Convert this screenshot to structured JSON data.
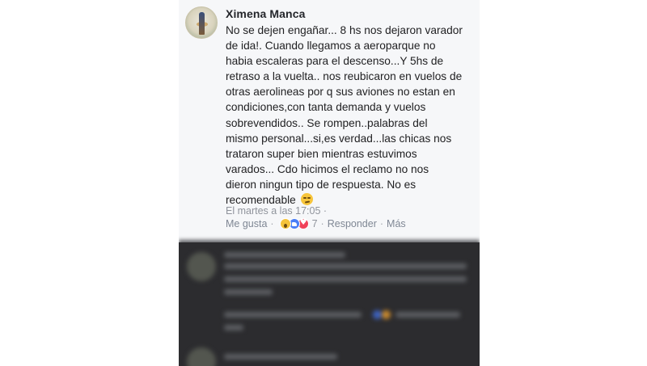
{
  "comment": {
    "author": "Ximena Manca",
    "text": "No se dejen engañar... 8 hs nos dejaron varador\nde ida!. Cuando llegamos a aeroparque no\nhabia escaleras para el descenso...Y 5hs de\nretraso a la vuelta.. nos reubicaron en vuelos de\notras aerolineas por q sus aviones no estan en\ncondiciones,con tanta demanda y vuelos\nsobrevendidos.. Se rompen..palabras del\nmismo personal...si,es verdad...las chicas nos\ntrataron super bien mientras estuvimos\nvarados... Cdo hicimos el reclamo no nos\ndieron ningun tipo de respuesta. No es\nrecomendable",
    "emoji": "smirk-face-emoji",
    "timestamp": "El martes a las 17:05 ·",
    "actions": {
      "like": "Me gusta",
      "separator": "·",
      "reaction_count": "7",
      "reply": "Responder",
      "more": "Más"
    },
    "reactions": [
      "wow-reaction-icon",
      "like-reaction-icon",
      "love-reaction-icon"
    ]
  },
  "colors": {
    "background": "#f6f7f9",
    "meta_text": "#90949c",
    "blurred_region": "#2c2c2f"
  }
}
